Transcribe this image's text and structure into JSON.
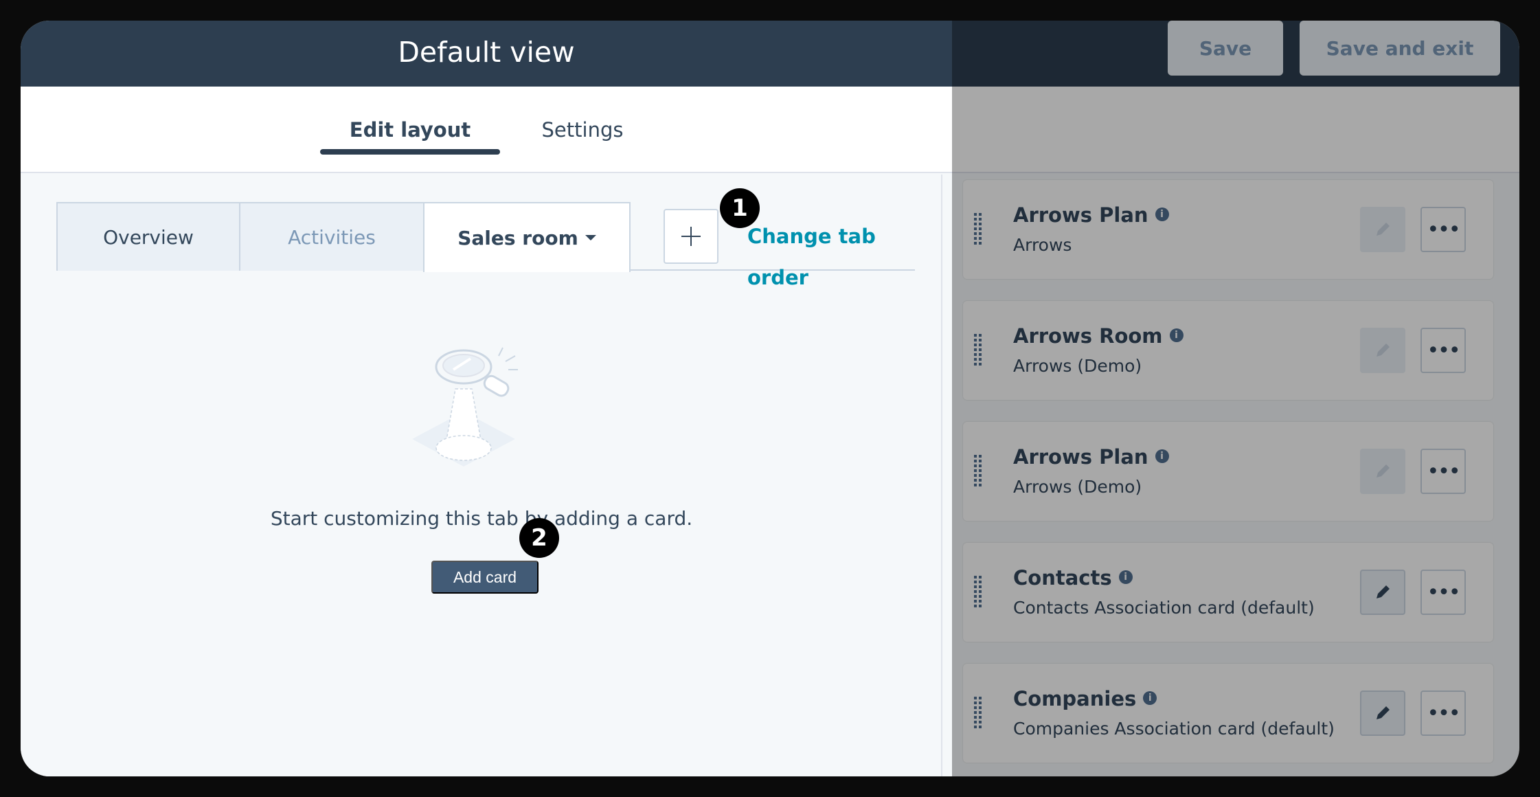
{
  "window": {
    "title": "Default view",
    "save_label": "Save",
    "save_exit_label": "Save and exit"
  },
  "main_tabs": [
    {
      "label": "Edit layout",
      "active": true
    },
    {
      "label": "Settings",
      "active": false
    }
  ],
  "sub_tabs": [
    {
      "label": "Overview",
      "state": "default"
    },
    {
      "label": "Activities",
      "state": "disabled"
    },
    {
      "label": "Sales room",
      "state": "active",
      "has_dropdown": true
    }
  ],
  "actions": {
    "add_tab_icon": "plus-icon",
    "change_tab_order_label": "Change tab order"
  },
  "badges": [
    "1",
    "2"
  ],
  "empty_state": {
    "message": "Start customizing this tab by adding a card.",
    "add_card_label": "Add card",
    "illustration_icon": "magnifier-illustration"
  },
  "cards": [
    {
      "title": "Arrows Plan",
      "subtitle": "Arrows",
      "edit_enabled": false
    },
    {
      "title": "Arrows Room",
      "subtitle": "Arrows (Demo)",
      "edit_enabled": false
    },
    {
      "title": "Arrows Plan",
      "subtitle": "Arrows (Demo)",
      "edit_enabled": false
    },
    {
      "title": "Contacts",
      "subtitle": "Contacts Association card (default)",
      "edit_enabled": true
    },
    {
      "title": "Companies",
      "subtitle": "Companies Association card (default)",
      "edit_enabled": true
    }
  ],
  "colors": {
    "topbar": "#2d3e50",
    "accent_link": "#0091ae",
    "primary_button": "#425b76",
    "text": "#33475b"
  }
}
